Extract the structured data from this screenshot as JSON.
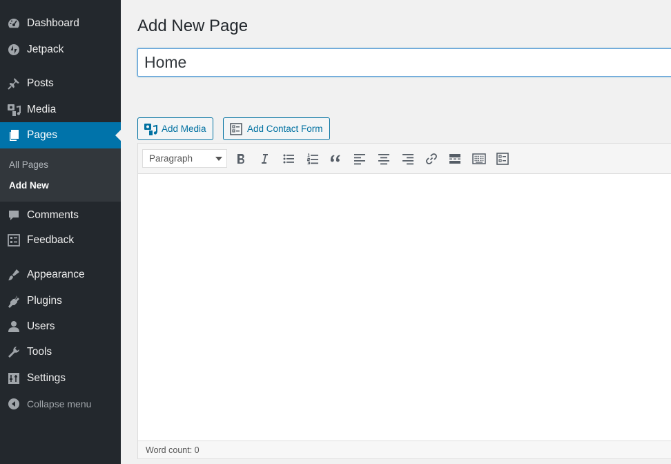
{
  "sidebar": {
    "items": [
      {
        "label": "Dashboard",
        "icon": "dashboard-icon"
      },
      {
        "label": "Jetpack",
        "icon": "jetpack-icon"
      },
      {
        "label": "Posts",
        "icon": "pin-icon"
      },
      {
        "label": "Media",
        "icon": "media-icon"
      },
      {
        "label": "Pages",
        "icon": "pages-icon",
        "current": true
      },
      {
        "label": "Comments",
        "icon": "comment-icon"
      },
      {
        "label": "Feedback",
        "icon": "feedback-icon"
      },
      {
        "label": "Appearance",
        "icon": "brush-icon"
      },
      {
        "label": "Plugins",
        "icon": "plugin-icon"
      },
      {
        "label": "Users",
        "icon": "user-icon"
      },
      {
        "label": "Tools",
        "icon": "wrench-icon"
      },
      {
        "label": "Settings",
        "icon": "settings-icon"
      },
      {
        "label": "Collapse menu",
        "icon": "collapse-icon"
      }
    ],
    "submenu": [
      {
        "label": "All Pages"
      },
      {
        "label": "Add New",
        "current": true
      }
    ]
  },
  "main": {
    "title": "Add New Page",
    "title_value": "Home",
    "add_media_label": "Add Media",
    "add_contact_form_label": "Add Contact Form"
  },
  "editor": {
    "format_select": "Paragraph",
    "toolbar": [
      "bold",
      "italic",
      "bulleted-list",
      "numbered-list",
      "blockquote",
      "align-left",
      "align-center",
      "align-right",
      "insert-link",
      "read-more",
      "toolbar-toggle",
      "contact-form"
    ],
    "word_count": "Word count: 0"
  },
  "colors": {
    "sidebar_bg": "#23282d",
    "submenu_bg": "#32373c",
    "accent": "#0073aa",
    "button_blue": "#0071a1",
    "icon_grey": "#a0a5aa"
  }
}
